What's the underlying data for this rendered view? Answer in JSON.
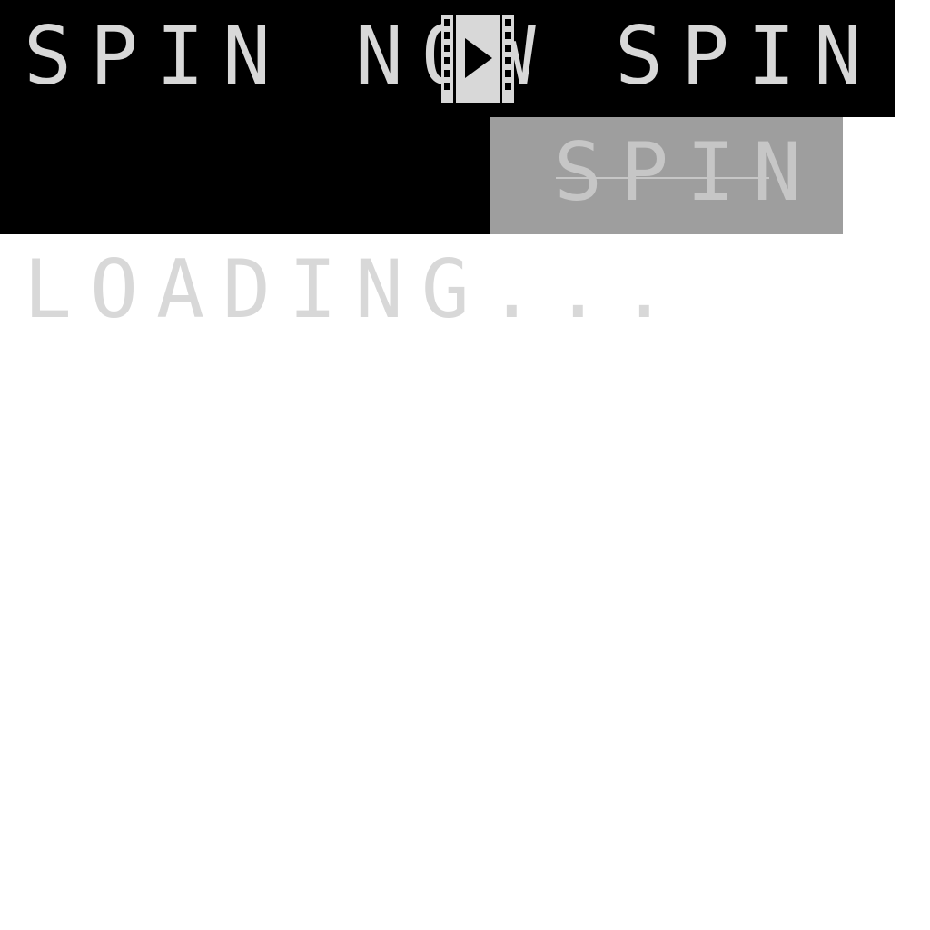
{
  "buttons": {
    "spin_now_label": "SPIN NOW",
    "spin_label": "SPIN",
    "disabled_spin_label": "SPIN"
  },
  "status": {
    "loading_text": "LOADING..."
  },
  "icons": {
    "film": "film-play-icon"
  },
  "colors": {
    "background": "#000000",
    "text": "#d8d8d8",
    "disabled_bg": "#9e9e9e",
    "disabled_text": "#c6c6c6"
  }
}
